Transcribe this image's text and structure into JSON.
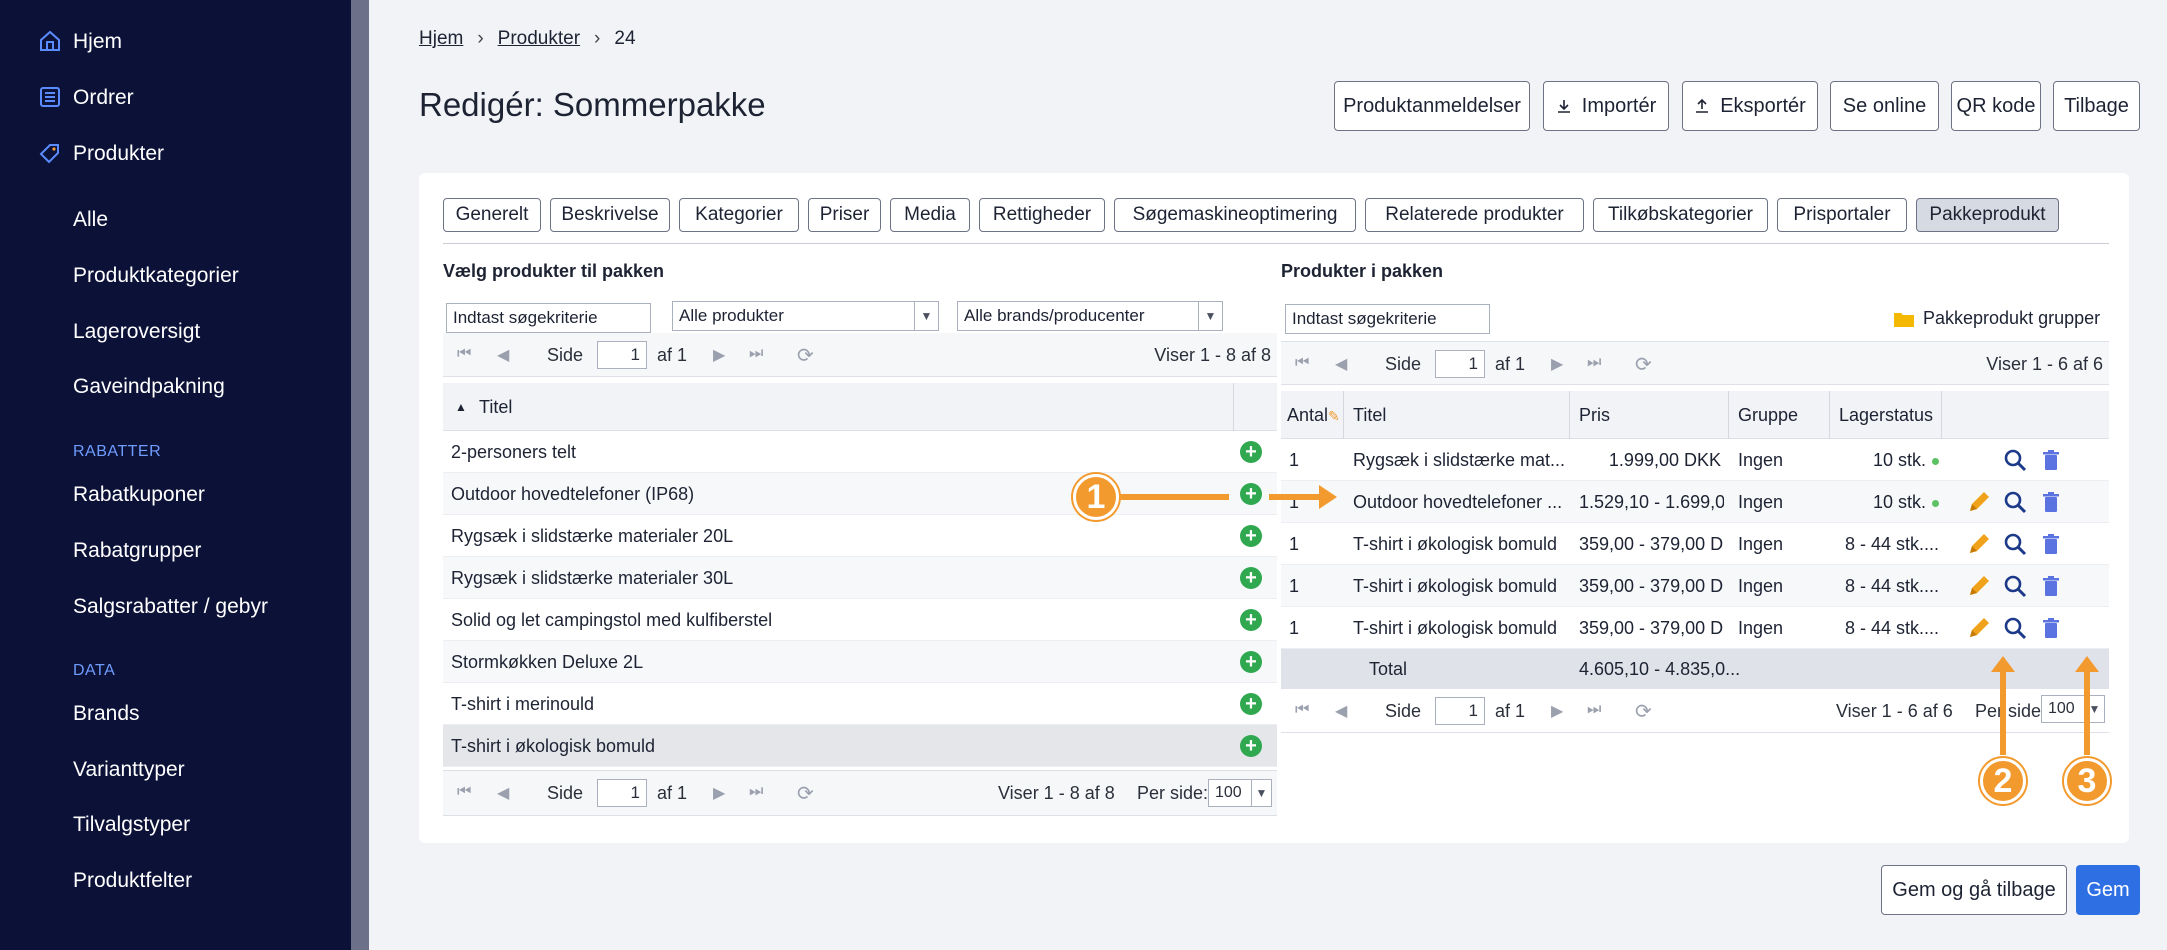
{
  "sidebar": {
    "items": [
      {
        "label": "Hjem",
        "icon": "home-icon"
      },
      {
        "label": "Ordrer",
        "icon": "orders-icon"
      },
      {
        "label": "Produkter",
        "icon": "tag-icon"
      },
      {
        "label": "Alle"
      },
      {
        "label": "Produktkategorier"
      },
      {
        "label": "Lageroversigt"
      },
      {
        "label": "Gaveindpakning"
      },
      {
        "label": "Rabatkuponer"
      },
      {
        "label": "Rabatgrupper"
      },
      {
        "label": "Salgsrabatter / gebyr"
      },
      {
        "label": "Brands"
      },
      {
        "label": "Varianttyper"
      },
      {
        "label": "Tilvalgstyper"
      },
      {
        "label": "Produktfelter"
      }
    ],
    "sections": {
      "rabatter": "RABATTER",
      "data": "DATA"
    }
  },
  "breadcrumb": {
    "home": "Hjem",
    "products": "Produkter",
    "current": "24",
    "sep": "›"
  },
  "page": {
    "title": "Redigér: Sommerpakke"
  },
  "header_buttons": {
    "reviews": "Produktanmeldelser",
    "import": "Importér",
    "export": "Eksportér",
    "online": "Se online",
    "qr": "QR kode",
    "back": "Tilbage"
  },
  "tabs": [
    "Generelt",
    "Beskrivelse",
    "Kategorier",
    "Priser",
    "Media",
    "Rettigheder",
    "Søgemaskineoptimering",
    "Relaterede produkter",
    "Tilkøbskategorier",
    "Prisportaler",
    "Pakkeprodukt"
  ],
  "left": {
    "title": "Vælg produkter til pakken",
    "search_placeholder": "Indtast søgekriterie",
    "filter_products": "Alle produkter",
    "filter_brands": "Alle brands/producenter",
    "pager": {
      "side": "Side",
      "page": "1",
      "of": "af 1",
      "showing": "Viser 1 - 8 af 8",
      "per_side": "Per side:",
      "per_value": "100"
    },
    "column_title": "Titel",
    "rows": [
      "2-personers telt",
      "Outdoor hovedtelefoner (IP68)",
      "Rygsæk i slidstærke materialer 20L",
      "Rygsæk i slidstærke materialer 30L",
      "Solid og let campingstol med kulfiberstel",
      "Stormkøkken Deluxe 2L",
      "T-shirt i merinould",
      "T-shirt i økologisk bomuld"
    ]
  },
  "right": {
    "title": "Produkter i pakken",
    "search_placeholder": "Indtast søgekriterie",
    "groups_link": "Pakkeprodukt grupper",
    "pager": {
      "side": "Side",
      "page": "1",
      "of": "af 1",
      "showing": "Viser 1 - 6 af 6",
      "per_side": "Per side:",
      "per_value": "100"
    },
    "columns": {
      "antal": "Antal",
      "titel": "Titel",
      "pris": "Pris",
      "gruppe": "Gruppe",
      "lager": "Lagerstatus"
    },
    "rows": [
      {
        "antal": "1",
        "titel": "Rygsæk i slidstærke mat...",
        "pris": "1.999,00 DKK",
        "gruppe": "Ingen",
        "lager": "10 stk.",
        "edit": false
      },
      {
        "antal": "1",
        "titel": "Outdoor hovedtelefoner ...",
        "pris": "1.529,10 - 1.699,0...",
        "gruppe": "Ingen",
        "lager": "10 stk.",
        "edit": true
      },
      {
        "antal": "1",
        "titel": "T-shirt i økologisk bomuld",
        "pris": "359,00 - 379,00 D...",
        "gruppe": "Ingen",
        "lager": "8 - 44 stk....",
        "edit": true
      },
      {
        "antal": "1",
        "titel": "T-shirt i økologisk bomuld",
        "pris": "359,00 - 379,00 D...",
        "gruppe": "Ingen",
        "lager": "8 - 44 stk....",
        "edit": true
      },
      {
        "antal": "1",
        "titel": "T-shirt i økologisk bomuld",
        "pris": "359,00 - 379,00 D...",
        "gruppe": "Ingen",
        "lager": "8 - 44 stk....",
        "edit": true
      }
    ],
    "total_label": "Total",
    "total_value": "4.605,10 - 4.835,0..."
  },
  "footer": {
    "save_back": "Gem og gå tilbage",
    "save": "Gem"
  },
  "callouts": [
    "1",
    "2",
    "3"
  ],
  "colors": {
    "sidebar": "#0b1137",
    "accent": "#2f6fe4",
    "callout": "#f39a2e",
    "plus": "#2fa84f"
  }
}
